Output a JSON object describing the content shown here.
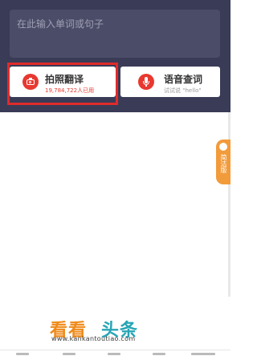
{
  "search": {
    "placeholder": "在此输入单词或句子"
  },
  "actions": {
    "photo": {
      "title": "拍照翻译",
      "subtitle": "19,784,722人已用",
      "icon": "camera-icon"
    },
    "voice": {
      "title": "语音查词",
      "subtitle": "试试说 \"hello\"",
      "icon": "microphone-icon"
    }
  },
  "side_tab": {
    "label": "简洁版"
  },
  "watermark": {
    "text1": "看看",
    "text2": "头条",
    "url": "www.kankantoutiao.com"
  },
  "colors": {
    "header_bg": "#3a3b57",
    "accent_red": "#e8382f",
    "highlight": "#e02b2b",
    "side_tab": "#f29b3b"
  }
}
